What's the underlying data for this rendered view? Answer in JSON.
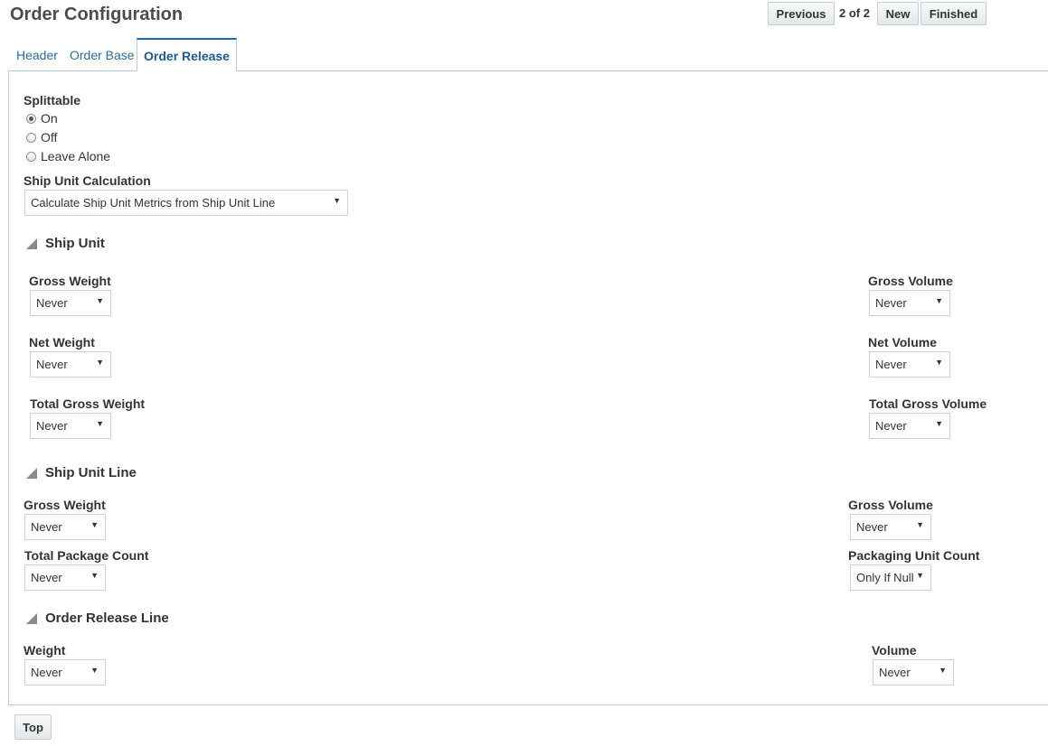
{
  "page": {
    "title": "Order Configuration"
  },
  "toolbar": {
    "previous_label": "Previous",
    "page_indicator": "2 of 2",
    "new_label": "New",
    "finished_label": "Finished"
  },
  "tabs": [
    {
      "label": "Header",
      "active": false
    },
    {
      "label": "Order Base",
      "active": false
    },
    {
      "label": "Order Release",
      "active": true
    }
  ],
  "splittable": {
    "label": "Splittable",
    "options": [
      {
        "label": "On",
        "checked": true
      },
      {
        "label": "Off",
        "checked": false
      },
      {
        "label": "Leave Alone",
        "checked": false
      }
    ]
  },
  "ship_unit_calc": {
    "label": "Ship Unit Calculation",
    "value": "Calculate Ship Unit Metrics from Ship Unit Line"
  },
  "ship_unit": {
    "title": "Ship Unit",
    "fields": [
      {
        "label": "Gross Weight",
        "value": "Never"
      },
      {
        "label": "Gross Volume",
        "value": "Never"
      },
      {
        "label": "Net Weight",
        "value": "Never"
      },
      {
        "label": "Net Volume",
        "value": "Never"
      },
      {
        "label": "Total Gross Weight",
        "value": "Never"
      },
      {
        "label": "Total Gross Volume",
        "value": "Never"
      }
    ]
  },
  "ship_unit_line": {
    "title": "Ship Unit Line",
    "fields": [
      {
        "label": "Gross Weight",
        "value": "Never"
      },
      {
        "label": "Gross Volume",
        "value": "Never"
      },
      {
        "label": "Total Package Count",
        "value": "Never"
      },
      {
        "label": "Packaging Unit Count",
        "value": "Only If Null"
      }
    ]
  },
  "order_release_line": {
    "title": "Order Release Line",
    "fields": [
      {
        "label": "Weight",
        "value": "Never"
      },
      {
        "label": "Volume",
        "value": "Never"
      }
    ]
  },
  "footer": {
    "top_label": "Top"
  },
  "icons": {
    "select_arrow": "▼",
    "section_toggle": "triangle-down-icon"
  }
}
